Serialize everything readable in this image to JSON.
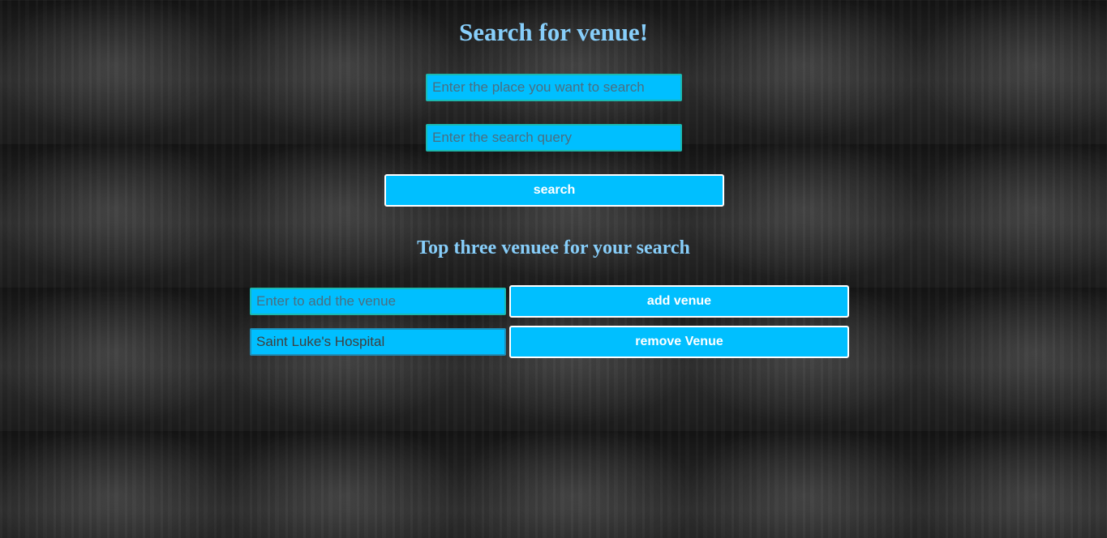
{
  "header": {
    "title": "Search for venue!"
  },
  "search": {
    "place_placeholder": "Enter the place you want to search",
    "query_placeholder": "Enter the search query",
    "button_label": "search"
  },
  "results": {
    "title": "Top three venuee for your search"
  },
  "venue": {
    "add_placeholder": "Enter to add the venue",
    "add_button_label": "add venue",
    "remove_value": "Saint Luke's Hospital",
    "remove_button_label": "remove Venue"
  },
  "colors": {
    "accent": "#00bfff",
    "title": "#87cefa",
    "background": "#1a1a1a"
  }
}
